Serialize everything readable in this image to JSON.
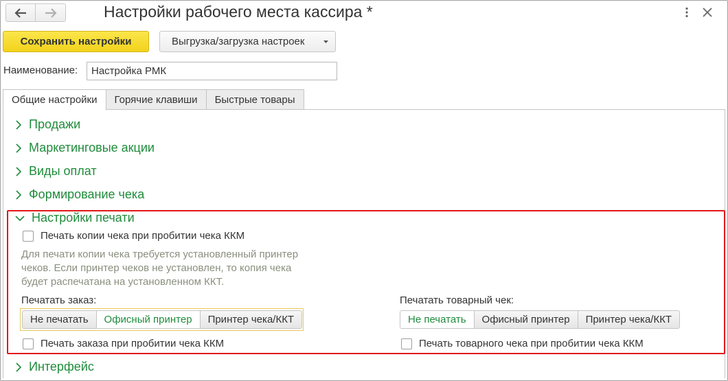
{
  "window": {
    "title": "Настройки рабочего места кассира *"
  },
  "toolbar": {
    "save_label": "Сохранить настройки",
    "export_label": "Выгрузка/загрузка настроек"
  },
  "name_field": {
    "label": "Наименование:",
    "value": "Настройка РМК"
  },
  "tabs": [
    {
      "label": "Общие настройки",
      "active": true
    },
    {
      "label": "Горячие клавиши",
      "active": false
    },
    {
      "label": "Быстрые товары",
      "active": false
    }
  ],
  "groups": {
    "sales": "Продажи",
    "marketing": "Маркетинговые акции",
    "payments": "Виды оплат",
    "receipt": "Формирование чека",
    "printing": "Настройки печати",
    "interface": "Интерфейс"
  },
  "printing": {
    "copy_checkbox_label": "Печать копии чека при пробитии чека ККМ",
    "copy_checked": false,
    "hint_lines": [
      "Для печати копии чека требуется установленный принтер",
      "чеков. Если принтер чеков не установлен, то копия чека",
      "будет распечатана на установленном ККТ."
    ],
    "order": {
      "label": "Печатать заказ:",
      "options": [
        "Не печатать",
        "Офисный принтер",
        "Принтер чека/ККТ"
      ],
      "selected": "Офисный принтер",
      "checkbox_label": "Печать заказа при пробитии чека ККМ"
    },
    "goods_receipt": {
      "label": "Печатать товарный чек:",
      "options": [
        "Не печатать",
        "Офисный принтер",
        "Принтер чека/ККТ"
      ],
      "selected": "Не печатать",
      "checkbox_label": "Печать товарного чека при пробитии чека ККМ"
    }
  },
  "colors": {
    "accent_green": "#1f8c3b",
    "save_yellow": "#f5d826",
    "highlight_red": "#e21616"
  }
}
